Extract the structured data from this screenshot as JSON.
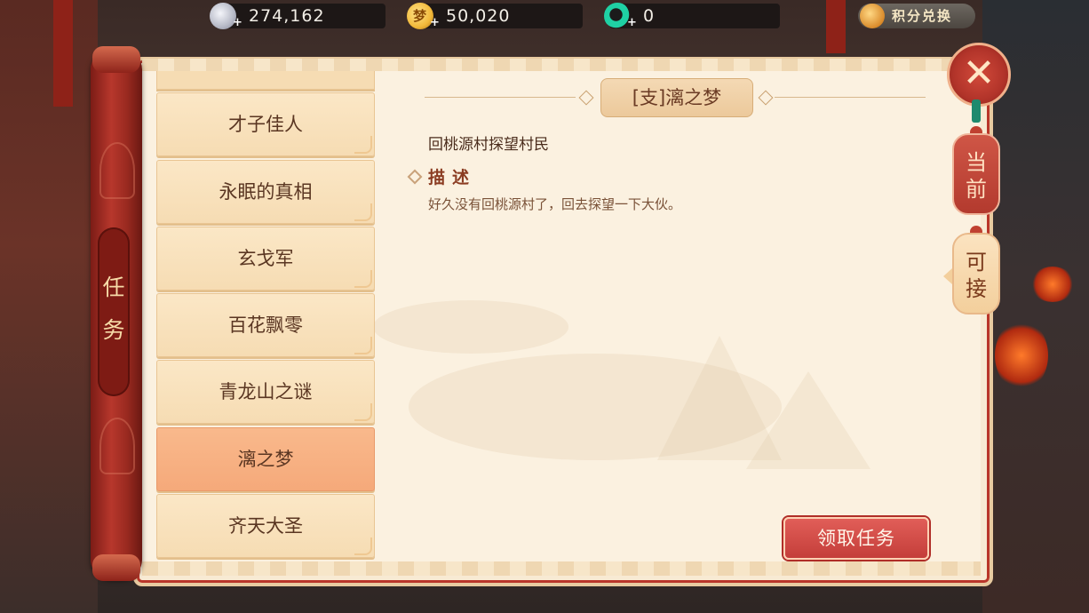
{
  "currencies": [
    {
      "name": "silver-coin",
      "value": "274,162",
      "color": "#c9ccd6"
    },
    {
      "name": "gold-coin",
      "value": "50,020",
      "color": "#f2b93a",
      "glyph": "梦"
    },
    {
      "name": "jade-token",
      "value": "0",
      "color": "#1fd1a4"
    }
  ],
  "exchange": {
    "label": "积分兑换"
  },
  "sidebar": {
    "title_line1": "任",
    "title_line2": "务"
  },
  "quests": [
    {
      "title": "才子佳人"
    },
    {
      "title": "永眠的真相"
    },
    {
      "title": "玄戈军"
    },
    {
      "title": "百花飘零"
    },
    {
      "title": "青龙山之谜"
    },
    {
      "title": "漓之梦",
      "selected": true
    },
    {
      "title": "齐天大圣"
    }
  ],
  "detail": {
    "title": "[支]漓之梦",
    "objective": "回桃源村探望村民",
    "description_heading": "描述",
    "description": "好久没有回桃源村了，回去探望一下大伙。"
  },
  "accept_button": {
    "label": "领取任务"
  },
  "tabs": {
    "current_line1": "当",
    "current_line2": "前",
    "available_line1": "可",
    "available_line2": "接"
  },
  "colors": {
    "accent_red": "#c43e3a",
    "panel_bg": "#fbf1e0",
    "selected_item": "#f5a97a"
  }
}
